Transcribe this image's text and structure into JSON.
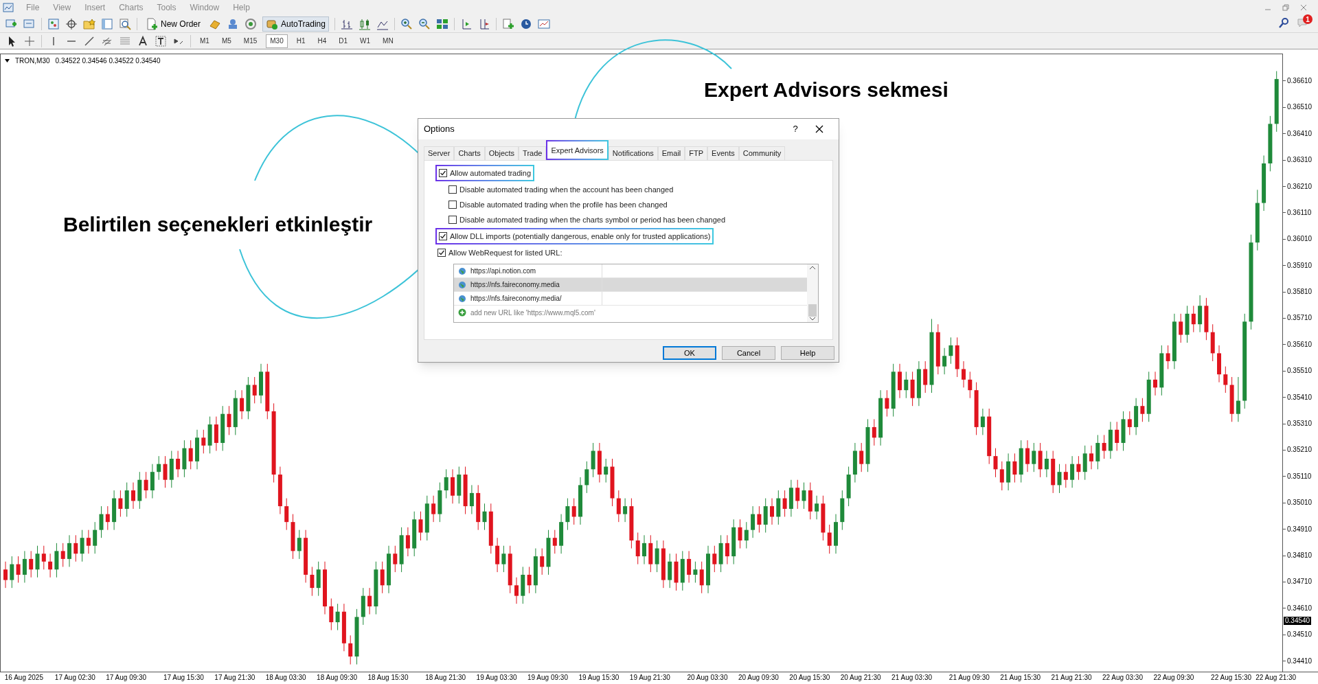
{
  "menu": [
    "File",
    "View",
    "Insert",
    "Charts",
    "Tools",
    "Window",
    "Help"
  ],
  "toolbar": {
    "new_order": "New Order",
    "autotrading": "AutoTrading"
  },
  "timeframes": [
    {
      "label": "M1",
      "selected": false
    },
    {
      "label": "M5",
      "selected": false
    },
    {
      "label": "M15",
      "selected": false
    },
    {
      "label": "M30",
      "selected": true
    },
    {
      "label": "H1",
      "selected": false
    },
    {
      "label": "H4",
      "selected": false
    },
    {
      "label": "D1",
      "selected": false
    },
    {
      "label": "W1",
      "selected": false
    },
    {
      "label": "MN",
      "selected": false
    }
  ],
  "notification_badge": "1",
  "chart": {
    "chart_data": {
      "type": "candlestick",
      "yticks": [
        {
          "value": 0.3661,
          "label": "0.36610"
        },
        {
          "value": 0.3651,
          "label": "0.36510"
        },
        {
          "value": 0.3641,
          "label": "0.36410"
        },
        {
          "value": 0.3631,
          "label": "0.36310"
        },
        {
          "value": 0.3621,
          "label": "0.36210"
        },
        {
          "value": 0.3611,
          "label": "0.36110"
        },
        {
          "value": 0.3601,
          "label": "0.36010"
        },
        {
          "value": 0.3591,
          "label": "0.35910"
        },
        {
          "value": 0.3581,
          "label": "0.35810"
        },
        {
          "value": 0.3571,
          "label": "0.35710"
        },
        {
          "value": 0.3561,
          "label": "0.35610"
        },
        {
          "value": 0.3551,
          "label": "0.35510"
        },
        {
          "value": 0.3541,
          "label": "0.35410"
        },
        {
          "value": 0.3531,
          "label": "0.35310"
        },
        {
          "value": 0.3521,
          "label": "0.35210"
        },
        {
          "value": 0.3511,
          "label": "0.35110"
        },
        {
          "value": 0.3501,
          "label": "0.35010"
        },
        {
          "value": 0.3491,
          "label": "0.34910"
        },
        {
          "value": 0.3481,
          "label": "0.34810"
        },
        {
          "value": 0.3471,
          "label": "0.34710"
        },
        {
          "value": 0.3461,
          "label": "0.34610"
        },
        {
          "value": 0.3451,
          "label": "0.34510"
        },
        {
          "value": 0.3441,
          "label": "0.34410"
        }
      ],
      "ylim": [
        0.3437,
        0.36714
      ],
      "categories": [
        null,
        null,
        null,
        "16 Aug 2025",
        null,
        null,
        null,
        null,
        null,
        null,
        null,
        "17 Aug 02:30",
        null,
        null,
        null,
        null,
        null,
        null,
        null,
        "17 Aug 09:30",
        null,
        null,
        null,
        null,
        null,
        null,
        null,
        null,
        "17 Aug 15:30",
        null,
        null,
        null,
        null,
        null,
        null,
        null,
        "17 Aug 21:30",
        null,
        null,
        null,
        null,
        null,
        null,
        null,
        "18 Aug 03:30",
        null,
        null,
        null,
        null,
        null,
        null,
        null,
        "18 Aug 09:30",
        null,
        null,
        null,
        null,
        null,
        null,
        null,
        "18 Aug 15:30",
        null,
        null,
        null,
        null,
        null,
        null,
        null,
        null,
        "18 Aug 21:30",
        null,
        null,
        null,
        null,
        null,
        null,
        null,
        "19 Aug 03:30",
        null,
        null,
        null,
        null,
        null,
        null,
        null,
        "19 Aug 09:30",
        null,
        null,
        null,
        null,
        null,
        null,
        null,
        "19 Aug 15:30",
        null,
        null,
        null,
        null,
        null,
        null,
        null,
        "19 Aug 21:30",
        null,
        null,
        null,
        null,
        null,
        null,
        null,
        null,
        "20 Aug 03:30",
        null,
        null,
        null,
        null,
        null,
        null,
        null,
        "20 Aug 09:30",
        null,
        null,
        null,
        null,
        null,
        null,
        null,
        "20 Aug 15:30",
        null,
        null,
        null,
        null,
        null,
        null,
        null,
        "20 Aug 21:30",
        null,
        null,
        null,
        null,
        null,
        null,
        null,
        "21 Aug 03:30",
        null,
        null,
        null,
        null,
        null,
        null,
        null,
        null,
        "21 Aug 09:30",
        null,
        null,
        null,
        null,
        null,
        null,
        null,
        "21 Aug 15:30",
        null,
        null,
        null,
        null,
        null,
        null,
        null,
        "21 Aug 21:30",
        null,
        null,
        null,
        null,
        null,
        null,
        null,
        "22 Aug 03:30",
        null,
        null,
        null,
        null,
        null,
        null,
        null,
        "22 Aug 09:30",
        null,
        null,
        null,
        null,
        null,
        null,
        null,
        null,
        "22 Aug 15:30",
        null,
        null,
        null,
        null,
        null,
        null,
        "22 Aug 21:30"
      ],
      "ohlc": [
        [
          0.3476,
          0.3479,
          0.3469,
          0.3472
        ],
        [
          0.3472,
          0.3481,
          0.3469,
          0.3478
        ],
        [
          0.3478,
          0.3481,
          0.3471,
          0.3474
        ],
        [
          0.3474,
          0.3483,
          0.3471,
          0.348
        ],
        [
          0.348,
          0.3483,
          0.3473,
          0.3476
        ],
        [
          0.3476,
          0.3485,
          0.3473,
          0.3482
        ],
        [
          0.3482,
          0.3485,
          0.3476,
          0.3479
        ],
        [
          0.3479,
          0.3482,
          0.3473,
          0.3476
        ],
        [
          0.3476,
          0.3486,
          0.3473,
          0.3483
        ],
        [
          0.3483,
          0.3486,
          0.3477,
          0.348
        ],
        [
          0.348,
          0.3489,
          0.3477,
          0.3486
        ],
        [
          0.3486,
          0.3489,
          0.3479,
          0.3482
        ],
        [
          0.3482,
          0.3491,
          0.3479,
          0.3488
        ],
        [
          0.3488,
          0.3491,
          0.3482,
          0.3485
        ],
        [
          0.3485,
          0.3494,
          0.3482,
          0.3491
        ],
        [
          0.3491,
          0.35,
          0.3488,
          0.3497
        ],
        [
          0.3497,
          0.35,
          0.3491,
          0.3494
        ],
        [
          0.3494,
          0.3506,
          0.3491,
          0.3503
        ],
        [
          0.3503,
          0.3506,
          0.3496,
          0.3499
        ],
        [
          0.3499,
          0.3509,
          0.3496,
          0.3506
        ],
        [
          0.3506,
          0.3509,
          0.3499,
          0.3502
        ],
        [
          0.3502,
          0.3513,
          0.3499,
          0.351
        ],
        [
          0.351,
          0.3513,
          0.3503,
          0.3506
        ],
        [
          0.3506,
          0.3516,
          0.3503,
          0.3513
        ],
        [
          0.3513,
          0.3519,
          0.351,
          0.3516
        ],
        [
          0.3516,
          0.3519,
          0.3507,
          0.351
        ],
        [
          0.351,
          0.3521,
          0.3507,
          0.3518
        ],
        [
          0.3518,
          0.3521,
          0.3511,
          0.3514
        ],
        [
          0.3514,
          0.3525,
          0.3511,
          0.3522
        ],
        [
          0.3522,
          0.3525,
          0.3514,
          0.3517
        ],
        [
          0.3517,
          0.3529,
          0.3514,
          0.3526
        ],
        [
          0.3526,
          0.3529,
          0.352,
          0.3523
        ],
        [
          0.3523,
          0.3534,
          0.352,
          0.3531
        ],
        [
          0.3531,
          0.3534,
          0.3521,
          0.3524
        ],
        [
          0.3524,
          0.3538,
          0.3521,
          0.3535
        ],
        [
          0.3535,
          0.3538,
          0.3527,
          0.353
        ],
        [
          0.353,
          0.3544,
          0.3527,
          0.3541
        ],
        [
          0.3541,
          0.3544,
          0.3533,
          0.3536
        ],
        [
          0.3536,
          0.3549,
          0.3533,
          0.3546
        ],
        [
          0.3546,
          0.3549,
          0.3539,
          0.3542
        ],
        [
          0.3542,
          0.3554,
          0.3539,
          0.3551
        ],
        [
          0.3551,
          0.3554,
          0.3533,
          0.3536
        ],
        [
          0.3536,
          0.3539,
          0.3509,
          0.3512
        ],
        [
          0.3512,
          0.3515,
          0.3497,
          0.35
        ],
        [
          0.35,
          0.3503,
          0.3491,
          0.3494
        ],
        [
          0.3494,
          0.3497,
          0.348,
          0.3483
        ],
        [
          0.3483,
          0.3491,
          0.348,
          0.3488
        ],
        [
          0.3488,
          0.3491,
          0.3471,
          0.3474
        ],
        [
          0.3474,
          0.3477,
          0.3466,
          0.3469
        ],
        [
          0.3469,
          0.3479,
          0.3466,
          0.3476
        ],
        [
          0.3476,
          0.3479,
          0.3459,
          0.3462
        ],
        [
          0.3462,
          0.3465,
          0.3453,
          0.3456
        ],
        [
          0.3456,
          0.3463,
          0.3453,
          0.346
        ],
        [
          0.346,
          0.3463,
          0.3445,
          0.3448
        ],
        [
          0.3448,
          0.3451,
          0.344,
          0.3443
        ],
        [
          0.3443,
          0.3461,
          0.344,
          0.3458
        ],
        [
          0.3458,
          0.3469,
          0.3455,
          0.3466
        ],
        [
          0.3466,
          0.3469,
          0.3459,
          0.3462
        ],
        [
          0.3462,
          0.3479,
          0.3459,
          0.3476
        ],
        [
          0.3476,
          0.3479,
          0.3467,
          0.347
        ],
        [
          0.347,
          0.3485,
          0.3467,
          0.3482
        ],
        [
          0.3482,
          0.3485,
          0.3475,
          0.3478
        ],
        [
          0.3478,
          0.3492,
          0.3475,
          0.3489
        ],
        [
          0.3489,
          0.3492,
          0.3481,
          0.3484
        ],
        [
          0.3484,
          0.3498,
          0.3481,
          0.3495
        ],
        [
          0.3495,
          0.3498,
          0.3487,
          0.349
        ],
        [
          0.349,
          0.3504,
          0.3487,
          0.3501
        ],
        [
          0.3501,
          0.3504,
          0.3494,
          0.3497
        ],
        [
          0.3497,
          0.3509,
          0.3494,
          0.3506
        ],
        [
          0.3506,
          0.3514,
          0.3503,
          0.3511
        ],
        [
          0.3511,
          0.3514,
          0.3501,
          0.3504
        ],
        [
          0.3504,
          0.3515,
          0.3501,
          0.3512
        ],
        [
          0.3512,
          0.3515,
          0.3497,
          0.35
        ],
        [
          0.35,
          0.3508,
          0.3497,
          0.3505
        ],
        [
          0.3505,
          0.3508,
          0.3491,
          0.3494
        ],
        [
          0.3494,
          0.3501,
          0.3491,
          0.3498
        ],
        [
          0.3498,
          0.3501,
          0.3482,
          0.3485
        ],
        [
          0.3485,
          0.3488,
          0.3475,
          0.3478
        ],
        [
          0.3478,
          0.3485,
          0.3475,
          0.3482
        ],
        [
          0.3482,
          0.3485,
          0.3467,
          0.347
        ],
        [
          0.347,
          0.3473,
          0.3463,
          0.3466
        ],
        [
          0.3466,
          0.3477,
          0.3463,
          0.3474
        ],
        [
          0.3474,
          0.3477,
          0.3467,
          0.347
        ],
        [
          0.347,
          0.3484,
          0.3467,
          0.3481
        ],
        [
          0.3481,
          0.3484,
          0.3474,
          0.3477
        ],
        [
          0.3477,
          0.3491,
          0.3474,
          0.3488
        ],
        [
          0.3488,
          0.3491,
          0.3482,
          0.3485
        ],
        [
          0.3485,
          0.3497,
          0.3482,
          0.3494
        ],
        [
          0.3494,
          0.3503,
          0.3491,
          0.35
        ],
        [
          0.35,
          0.3503,
          0.3493,
          0.3496
        ],
        [
          0.3496,
          0.3511,
          0.3493,
          0.3508
        ],
        [
          0.3508,
          0.3517,
          0.3505,
          0.3514
        ],
        [
          0.3514,
          0.3524,
          0.3511,
          0.3521
        ],
        [
          0.3521,
          0.3524,
          0.3509,
          0.3512
        ],
        [
          0.3512,
          0.3518,
          0.3509,
          0.3515
        ],
        [
          0.3515,
          0.3518,
          0.35,
          0.3503
        ],
        [
          0.3503,
          0.3506,
          0.3494,
          0.3497
        ],
        [
          0.3497,
          0.3503,
          0.3494,
          0.35
        ],
        [
          0.35,
          0.3503,
          0.3484,
          0.3487
        ],
        [
          0.3487,
          0.349,
          0.3478,
          0.3481
        ],
        [
          0.3481,
          0.3489,
          0.3478,
          0.3486
        ],
        [
          0.3486,
          0.3489,
          0.3475,
          0.3478
        ],
        [
          0.3478,
          0.3487,
          0.3475,
          0.3484
        ],
        [
          0.3484,
          0.3487,
          0.3469,
          0.3472
        ],
        [
          0.3472,
          0.3482,
          0.3469,
          0.3479
        ],
        [
          0.3479,
          0.3482,
          0.3468,
          0.3471
        ],
        [
          0.3471,
          0.3483,
          0.3468,
          0.348
        ],
        [
          0.348,
          0.3483,
          0.3471,
          0.3474
        ],
        [
          0.3474,
          0.3479,
          0.3471,
          0.3476
        ],
        [
          0.3476,
          0.3479,
          0.3467,
          0.347
        ],
        [
          0.347,
          0.3485,
          0.3467,
          0.3482
        ],
        [
          0.3482,
          0.3485,
          0.3475,
          0.3478
        ],
        [
          0.3478,
          0.3489,
          0.3475,
          0.3486
        ],
        [
          0.3486,
          0.3489,
          0.3478,
          0.3481
        ],
        [
          0.3481,
          0.3495,
          0.3478,
          0.3492
        ],
        [
          0.3492,
          0.3495,
          0.3484,
          0.3487
        ],
        [
          0.3487,
          0.3494,
          0.3484,
          0.3491
        ],
        [
          0.3491,
          0.35,
          0.3488,
          0.3497
        ],
        [
          0.3497,
          0.35,
          0.349,
          0.3493
        ],
        [
          0.3493,
          0.3503,
          0.349,
          0.35
        ],
        [
          0.35,
          0.3503,
          0.3493,
          0.3496
        ],
        [
          0.3496,
          0.3506,
          0.3493,
          0.3503
        ],
        [
          0.3503,
          0.3506,
          0.3496,
          0.3499
        ],
        [
          0.3499,
          0.351,
          0.3496,
          0.3507
        ],
        [
          0.3507,
          0.351,
          0.3499,
          0.3502
        ],
        [
          0.3502,
          0.3509,
          0.3499,
          0.3506
        ],
        [
          0.3506,
          0.3509,
          0.3495,
          0.3498
        ],
        [
          0.3498,
          0.3504,
          0.3495,
          0.3501
        ],
        [
          0.3501,
          0.3504,
          0.3487,
          0.349
        ],
        [
          0.349,
          0.3493,
          0.3482,
          0.3485
        ],
        [
          0.3485,
          0.3497,
          0.3482,
          0.3494
        ],
        [
          0.3494,
          0.3506,
          0.3491,
          0.3503
        ],
        [
          0.3503,
          0.3515,
          0.35,
          0.3512
        ],
        [
          0.3512,
          0.3524,
          0.3509,
          0.3521
        ],
        [
          0.3521,
          0.3524,
          0.3513,
          0.3516
        ],
        [
          0.3516,
          0.3533,
          0.3513,
          0.353
        ],
        [
          0.353,
          0.3533,
          0.3523,
          0.3526
        ],
        [
          0.3526,
          0.3544,
          0.3523,
          0.3541
        ],
        [
          0.3541,
          0.3544,
          0.3534,
          0.3537
        ],
        [
          0.3537,
          0.3554,
          0.3534,
          0.3551
        ],
        [
          0.3551,
          0.3554,
          0.3541,
          0.3544
        ],
        [
          0.3544,
          0.3551,
          0.3541,
          0.3548
        ],
        [
          0.3548,
          0.3551,
          0.3538,
          0.3541
        ],
        [
          0.3541,
          0.3555,
          0.3538,
          0.3552
        ],
        [
          0.3552,
          0.3555,
          0.3543,
          0.3546
        ],
        [
          0.3546,
          0.3571,
          0.3543,
          0.3566
        ],
        [
          0.3566,
          0.3569,
          0.355,
          0.3553
        ],
        [
          0.3553,
          0.356,
          0.355,
          0.3557
        ],
        [
          0.3557,
          0.3564,
          0.3554,
          0.3561
        ],
        [
          0.3561,
          0.3564,
          0.3549,
          0.3552
        ],
        [
          0.3552,
          0.3555,
          0.3545,
          0.3548
        ],
        [
          0.3548,
          0.3551,
          0.3541,
          0.3544
        ],
        [
          0.3544,
          0.3547,
          0.3527,
          0.353
        ],
        [
          0.353,
          0.3537,
          0.3527,
          0.3534
        ],
        [
          0.3534,
          0.3537,
          0.3516,
          0.3519
        ],
        [
          0.3519,
          0.3522,
          0.3511,
          0.3514
        ],
        [
          0.3514,
          0.3517,
          0.3506,
          0.3509
        ],
        [
          0.3509,
          0.352,
          0.3506,
          0.3517
        ],
        [
          0.3517,
          0.352,
          0.3509,
          0.3512
        ],
        [
          0.3512,
          0.3525,
          0.3509,
          0.3522
        ],
        [
          0.3522,
          0.3525,
          0.3513,
          0.3516
        ],
        [
          0.3516,
          0.3524,
          0.3513,
          0.3521
        ],
        [
          0.3521,
          0.3524,
          0.3511,
          0.3514
        ],
        [
          0.3514,
          0.3521,
          0.3511,
          0.3518
        ],
        [
          0.3518,
          0.3521,
          0.3505,
          0.3508
        ],
        [
          0.3508,
          0.3516,
          0.3505,
          0.3513
        ],
        [
          0.3513,
          0.3516,
          0.3507,
          0.351
        ],
        [
          0.351,
          0.3519,
          0.3507,
          0.3516
        ],
        [
          0.3516,
          0.3519,
          0.351,
          0.3513
        ],
        [
          0.3513,
          0.3523,
          0.351,
          0.352
        ],
        [
          0.352,
          0.3523,
          0.3514,
          0.3517
        ],
        [
          0.3517,
          0.3527,
          0.3514,
          0.3524
        ],
        [
          0.3524,
          0.3527,
          0.3518,
          0.3521
        ],
        [
          0.3521,
          0.3532,
          0.3518,
          0.3529
        ],
        [
          0.3529,
          0.3532,
          0.3521,
          0.3524
        ],
        [
          0.3524,
          0.3536,
          0.3521,
          0.3533
        ],
        [
          0.3533,
          0.3536,
          0.3527,
          0.353
        ],
        [
          0.353,
          0.3541,
          0.3527,
          0.3538
        ],
        [
          0.3538,
          0.3541,
          0.3532,
          0.3535
        ],
        [
          0.3535,
          0.3551,
          0.3532,
          0.3548
        ],
        [
          0.3548,
          0.3551,
          0.3542,
          0.3545
        ],
        [
          0.3545,
          0.3561,
          0.3542,
          0.3558
        ],
        [
          0.3558,
          0.3561,
          0.3552,
          0.3555
        ],
        [
          0.3555,
          0.3573,
          0.3552,
          0.357
        ],
        [
          0.357,
          0.3573,
          0.3562,
          0.3565
        ],
        [
          0.3565,
          0.3576,
          0.3562,
          0.3573
        ],
        [
          0.3573,
          0.3576,
          0.3566,
          0.3569
        ],
        [
          0.3569,
          0.358,
          0.3566,
          0.3576
        ],
        [
          0.3576,
          0.3579,
          0.3563,
          0.3566
        ],
        [
          0.3566,
          0.3569,
          0.3555,
          0.3558
        ],
        [
          0.3558,
          0.3561,
          0.3547,
          0.355
        ],
        [
          0.355,
          0.3553,
          0.3543,
          0.3546
        ],
        [
          0.3546,
          0.3549,
          0.3532,
          0.3535
        ],
        [
          0.3535,
          0.3549,
          0.3532,
          0.354
        ],
        [
          0.354,
          0.3573,
          0.3537,
          0.357
        ],
        [
          0.357,
          0.3603,
          0.3567,
          0.36
        ],
        [
          0.36,
          0.362,
          0.3597,
          0.3615
        ],
        [
          0.3615,
          0.3633,
          0.3612,
          0.363
        ],
        [
          0.363,
          0.3648,
          0.3627,
          0.3645
        ],
        [
          0.3645,
          0.3665,
          0.3642,
          0.3662
        ]
      ]
    },
    "symbol": "TRON,M30",
    "quotes": "0.34522 0.34546 0.34522 0.34540",
    "current_price": "0.34540"
  },
  "dialog": {
    "title": "Options",
    "help": "?",
    "tabs": [
      {
        "label": "Server",
        "selected": false,
        "highlighted": false
      },
      {
        "label": "Charts",
        "selected": false,
        "highlighted": false
      },
      {
        "label": "Objects",
        "selected": false,
        "highlighted": false
      },
      {
        "label": "Trade",
        "selected": false,
        "highlighted": false
      },
      {
        "label": "Expert Advisors",
        "selected": true,
        "highlighted": true
      },
      {
        "label": "Notifications",
        "selected": false,
        "highlighted": false
      },
      {
        "label": "Email",
        "selected": false,
        "highlighted": false
      },
      {
        "label": "FTP",
        "selected": false,
        "highlighted": false
      },
      {
        "label": "Events",
        "selected": false,
        "highlighted": false
      },
      {
        "label": "Community",
        "selected": false,
        "highlighted": false
      }
    ],
    "options": [
      {
        "label": "Allow automated trading",
        "checked": true,
        "highlighted": true,
        "children": [
          {
            "label": "Disable automated trading when the account has been changed",
            "checked": false,
            "highlighted": false
          },
          {
            "label": "Disable automated trading when the profile has been changed",
            "checked": false,
            "highlighted": false
          },
          {
            "label": "Disable automated trading when the charts symbol or period has been changed",
            "checked": false,
            "highlighted": false
          }
        ]
      },
      {
        "label": "Allow DLL imports (potentially dangerous, enable only for trusted applications)",
        "checked": true,
        "highlighted": true
      },
      {
        "label": "Allow WebRequest for listed URL:",
        "checked": true,
        "highlighted": false
      }
    ],
    "urls": [
      {
        "kind": "url",
        "text": "https://api.notion.com",
        "selected": false
      },
      {
        "kind": "url",
        "text": "https://nfs.faireconomy.media",
        "selected": true
      },
      {
        "kind": "url",
        "text": "https://nfs.faireconomy.media/",
        "selected": false
      },
      {
        "kind": "add",
        "text": "add new URL like 'https://www.mql5.com'",
        "selected": false
      }
    ],
    "buttons": [
      {
        "label": "OK",
        "default": true
      },
      {
        "label": "Cancel",
        "default": false
      },
      {
        "label": "Help",
        "default": false
      }
    ]
  },
  "annotations": [
    "Expert Advisors sekmesi",
    "Belirtilen seçenekleri etkinleştir"
  ]
}
